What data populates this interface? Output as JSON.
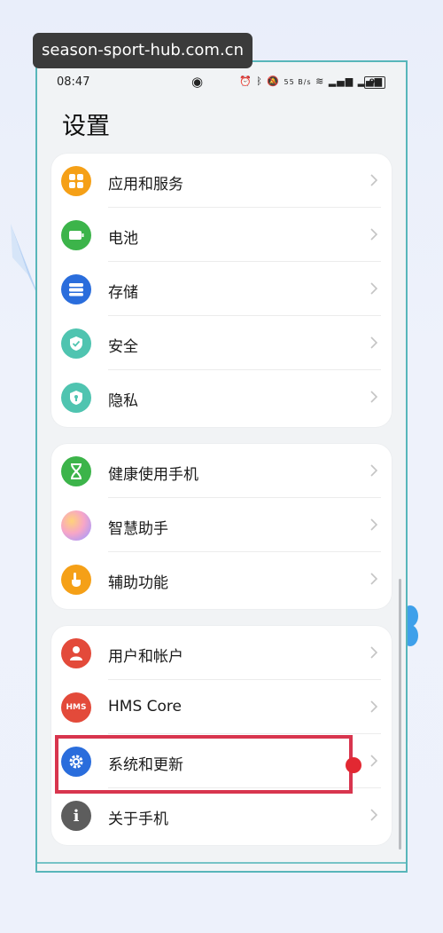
{
  "watermark": "season-sport-hub.com.cn",
  "status_bar": {
    "time": "08:47",
    "speed": "55 B/s",
    "battery": "95"
  },
  "page_title": "设置",
  "groups": [
    {
      "items": [
        {
          "label": "应用和服务",
          "icon": "apps-icon",
          "color": "#f5a017"
        },
        {
          "label": "电池",
          "icon": "battery-icon",
          "color": "#3cb44a"
        },
        {
          "label": "存储",
          "icon": "storage-icon",
          "color": "#2a6ddc"
        },
        {
          "label": "安全",
          "icon": "security-shield-icon",
          "color": "#4fc4b0"
        },
        {
          "label": "隐私",
          "icon": "privacy-shield-icon",
          "color": "#4fc4b0"
        }
      ]
    },
    {
      "items": [
        {
          "label": "健康使用手机",
          "icon": "hourglass-icon",
          "color": "#3cb44a"
        },
        {
          "label": "智慧助手",
          "icon": "assistant-icon",
          "color": "#e98ad0"
        },
        {
          "label": "辅助功能",
          "icon": "accessibility-hand-icon",
          "color": "#f5a017"
        }
      ]
    },
    {
      "items": [
        {
          "label": "用户和帐户",
          "icon": "user-icon",
          "color": "#e34a3a"
        },
        {
          "label": "HMS Core",
          "icon": "hms-icon",
          "color": "#e34a3a",
          "icon_text": "HMS"
        },
        {
          "label": "系统和更新",
          "icon": "system-gear-icon",
          "color": "#2a6ddc"
        },
        {
          "label": "关于手机",
          "icon": "info-icon",
          "color": "#5d5d5d",
          "icon_text": "i"
        }
      ]
    }
  ]
}
